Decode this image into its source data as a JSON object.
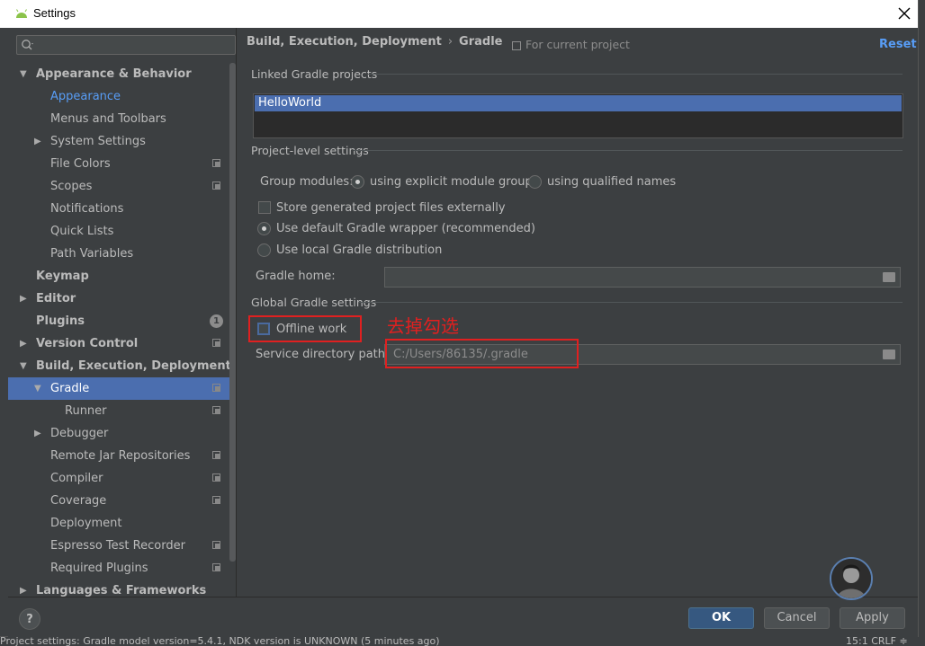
{
  "window": {
    "title": "Settings"
  },
  "sidebar": {
    "search_placeholder": "",
    "items": [
      {
        "label": "Appearance & Behavior",
        "level": 0,
        "bold": true,
        "arrow": "▼"
      },
      {
        "label": "Appearance",
        "level": 1,
        "link": true
      },
      {
        "label": "Menus and Toolbars",
        "level": 1
      },
      {
        "label": "System Settings",
        "level": 1,
        "arrow": "▶"
      },
      {
        "label": "File Colors",
        "level": 1,
        "project": true
      },
      {
        "label": "Scopes",
        "level": 1,
        "project": true
      },
      {
        "label": "Notifications",
        "level": 1
      },
      {
        "label": "Quick Lists",
        "level": 1
      },
      {
        "label": "Path Variables",
        "level": 1
      },
      {
        "label": "Keymap",
        "level": 0,
        "bold": true
      },
      {
        "label": "Editor",
        "level": 0,
        "bold": true,
        "arrow": "▶"
      },
      {
        "label": "Plugins",
        "level": 0,
        "bold": true,
        "badge": "1"
      },
      {
        "label": "Version Control",
        "level": 0,
        "bold": true,
        "arrow": "▶",
        "project": true
      },
      {
        "label": "Build, Execution, Deployment",
        "level": 0,
        "bold": true,
        "arrow": "▼"
      },
      {
        "label": "Gradle",
        "level": 1,
        "arrow": "▼",
        "project": true,
        "selected": true
      },
      {
        "label": "Runner",
        "level": 2,
        "project": true
      },
      {
        "label": "Debugger",
        "level": 1,
        "arrow": "▶"
      },
      {
        "label": "Remote Jar Repositories",
        "level": 1,
        "project": true
      },
      {
        "label": "Compiler",
        "level": 1,
        "project": true
      },
      {
        "label": "Coverage",
        "level": 1,
        "project": true
      },
      {
        "label": "Deployment",
        "level": 1
      },
      {
        "label": "Espresso Test Recorder",
        "level": 1,
        "project": true
      },
      {
        "label": "Required Plugins",
        "level": 1,
        "project": true
      },
      {
        "label": "Languages & Frameworks",
        "level": 0,
        "bold": true,
        "arrow": "▶"
      }
    ]
  },
  "header": {
    "crumb_parent": "Build, Execution, Deployment",
    "crumb_sep": "›",
    "crumb_current": "Gradle",
    "for_current_project": "For current project",
    "reset": "Reset"
  },
  "linked": {
    "section": "Linked Gradle projects",
    "projects": [
      "HelloWorld"
    ]
  },
  "project_level": {
    "section": "Project-level settings",
    "group_modules_label": "Group modules:",
    "group_opt1": "using explicit module groups",
    "group_opt2": "using qualified names",
    "store_externally": "Store generated project files externally",
    "use_default_wrapper": "Use default Gradle wrapper (recommended)",
    "use_local": "Use local Gradle distribution",
    "gradle_home_label": "Gradle home:",
    "gradle_home_value": ""
  },
  "global": {
    "section": "Global Gradle settings",
    "offline_work": "Offline work",
    "service_dir_label": "Service directory path:",
    "service_dir_value": "C:/Users/86135/.gradle"
  },
  "annotation": {
    "text": "去掉勾选"
  },
  "footer": {
    "help": "?",
    "ok": "OK",
    "cancel": "Cancel",
    "apply": "Apply"
  },
  "status_bar": {
    "left": "Project settings: Gradle model version=5.4.1, NDK version is UNKNOWN (5 minutes ago)",
    "right": "15:1   CRLF ≑"
  }
}
